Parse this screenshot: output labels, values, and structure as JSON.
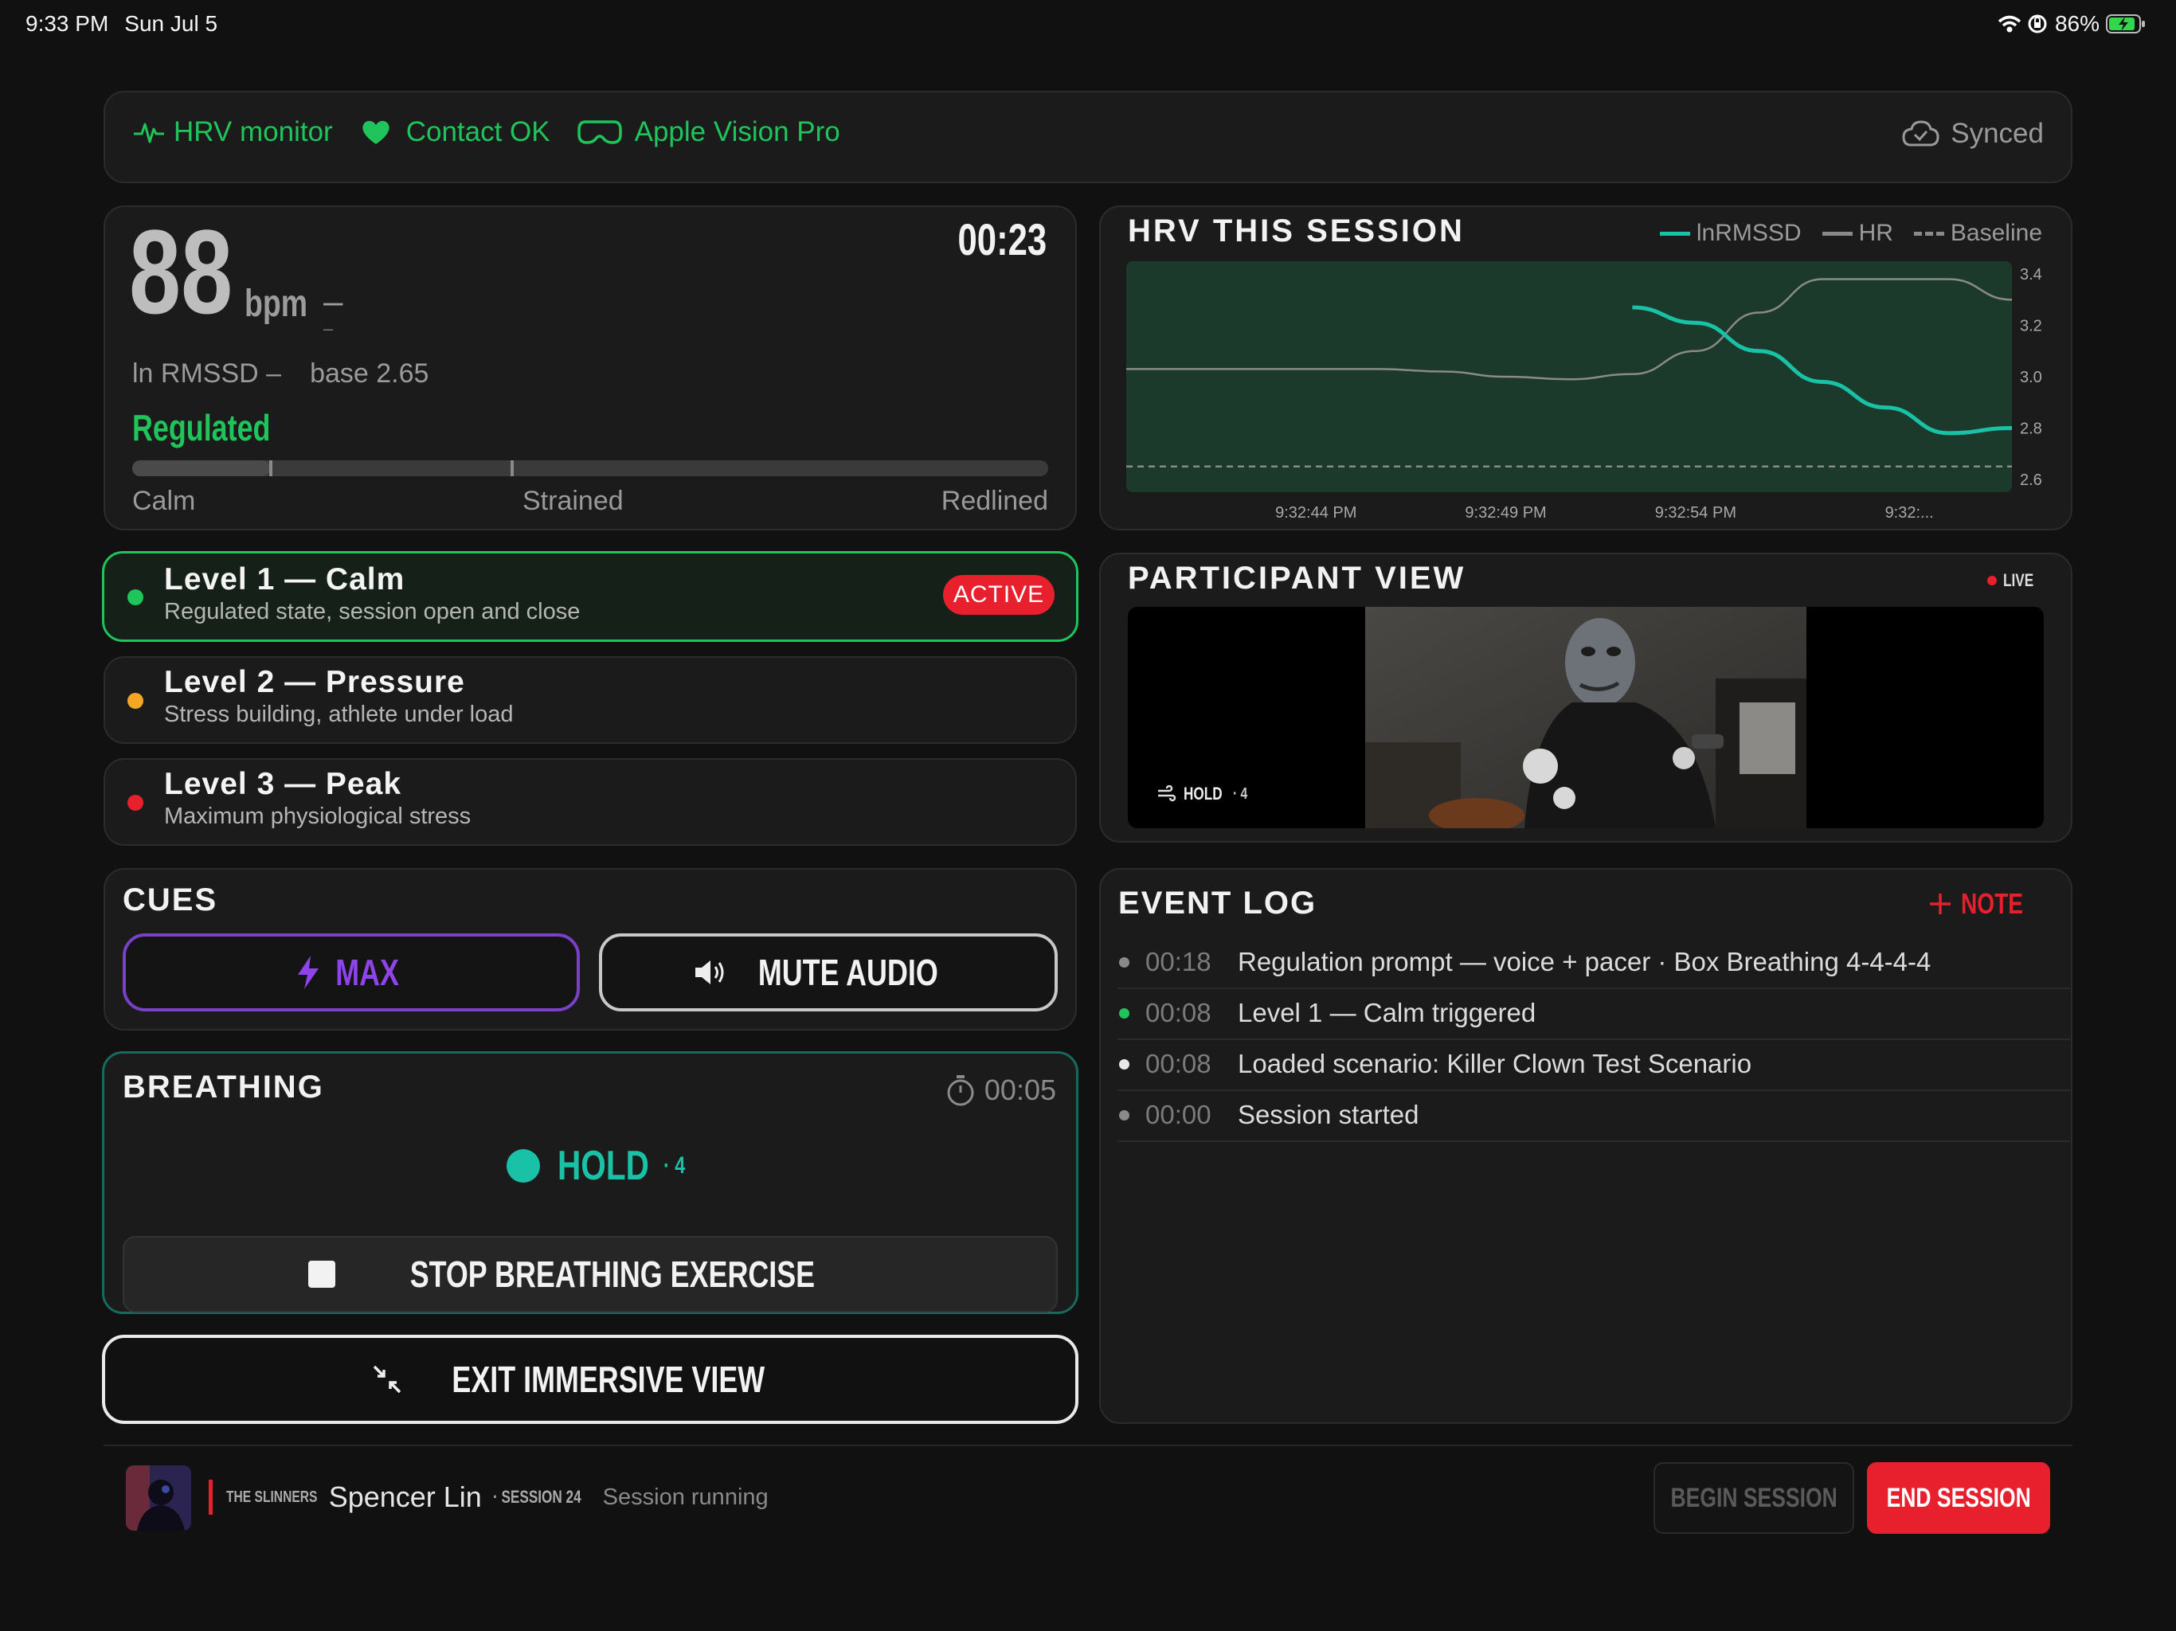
{
  "status_bar": {
    "time": "9:33 PM",
    "date": "Sun Jul 5",
    "battery": "86%"
  },
  "top_bar": {
    "hrv_monitor": "HRV monitor",
    "contact": "Contact OK",
    "device": "Apple Vision Pro",
    "sync": "Synced"
  },
  "vitals": {
    "bpm_value": "88",
    "bpm_unit": "bpm",
    "bpm_delta": "–",
    "bpm_delta_sub": "–",
    "timer": "00:23",
    "rmssd_label": "ln RMSSD –",
    "baseline_label": "base 2.65",
    "state": "Regulated",
    "stress_level": 0.15,
    "scale_labels": [
      "Calm",
      "Strained",
      "Redlined"
    ]
  },
  "levels": [
    {
      "title": "Level 1 — Calm",
      "subtitle": "Regulated state, session open and close",
      "color": "#1fc45a",
      "badge": "ACTIVE"
    },
    {
      "title": "Level 2 — Pressure",
      "subtitle": "Stress building, athlete under load",
      "color": "#f5a623"
    },
    {
      "title": "Level 3 — Peak",
      "subtitle": "Maximum physiological stress",
      "color": "#e8202e"
    }
  ],
  "cues": {
    "title": "CUES",
    "max_label": "MAX",
    "mute_label": "MUTE AUDIO"
  },
  "breathing": {
    "title": "BREATHING",
    "elapsed": "00:05",
    "phase": "HOLD",
    "count": "· 4",
    "stop_label": "STOP BREATHING EXERCISE"
  },
  "exit_label": "EXIT IMMERSIVE VIEW",
  "hrv_chart": {
    "title": "HRV THIS SESSION",
    "legend": [
      "lnRMSSD",
      "HR",
      "Baseline"
    ]
  },
  "chart_data": {
    "type": "line",
    "title": "HRV THIS SESSION",
    "x_ticks": [
      "9:32:44 PM",
      "9:32:49 PM",
      "9:32:54 PM",
      "9:32:..."
    ],
    "y_ticks": [
      3.4,
      3.2,
      3.0,
      2.8,
      2.6
    ],
    "ylim": [
      2.55,
      3.45
    ],
    "x": [
      0,
      4,
      8,
      12,
      16,
      20,
      24,
      28,
      32,
      36,
      40,
      44,
      48,
      52,
      56
    ],
    "series": [
      {
        "name": "lnRMSSD",
        "color": "#19c2a6",
        "values": [
          null,
          null,
          null,
          null,
          null,
          null,
          null,
          null,
          3.27,
          3.21,
          3.1,
          2.98,
          2.88,
          2.78,
          2.8
        ]
      },
      {
        "name": "HR",
        "color": "#8a8a8a",
        "values": [
          3.03,
          3.03,
          3.03,
          3.03,
          3.03,
          3.02,
          3.0,
          2.99,
          3.01,
          3.1,
          3.25,
          3.38,
          3.38,
          3.38,
          3.3
        ]
      },
      {
        "name": "Baseline",
        "color": "#8a8a8a",
        "values": [
          2.65,
          2.65,
          2.65,
          2.65,
          2.65,
          2.65,
          2.65,
          2.65,
          2.65,
          2.65,
          2.65,
          2.65,
          2.65,
          2.65,
          2.65
        ]
      }
    ],
    "grid": false,
    "legend_position": "top-right"
  },
  "participant_view": {
    "title": "PARTICIPANT VIEW",
    "live": "LIVE",
    "overlay_phase": "HOLD",
    "overlay_count": "· 4"
  },
  "event_log": {
    "title": "EVENT LOG",
    "note_label": "NOTE",
    "entries": [
      {
        "time": "00:18",
        "text": "Regulation prompt — voice + pacer · Box Breathing 4-4-4-4",
        "dot": "#8a8a8a"
      },
      {
        "time": "00:08",
        "text": "Level 1 — Calm triggered",
        "dot": "#1fc45a"
      },
      {
        "time": "00:08",
        "text": "Loaded scenario: Killer Clown Test Scenario",
        "dot": "#e8e8e8"
      },
      {
        "time": "00:00",
        "text": "Session started",
        "dot": "#8a8a8a"
      }
    ]
  },
  "footer": {
    "team": "THE SLINNERS",
    "athlete": "Spencer Lin",
    "session": "· SESSION 24",
    "status": "Session running",
    "begin_label": "BEGIN SESSION",
    "end_label": "END SESSION"
  },
  "colors": {
    "accent_green": "#1fc45a",
    "teal": "#19c2a6",
    "red": "#e8202e",
    "purple": "#8e44e8"
  }
}
